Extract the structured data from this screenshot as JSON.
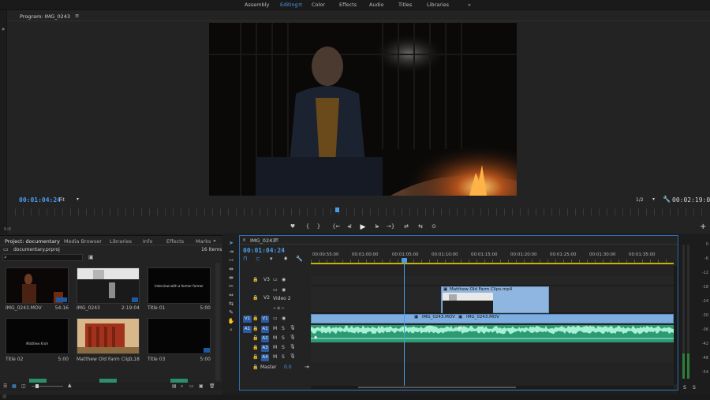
{
  "workspaces": [
    "Assembly",
    "Editing",
    "Color",
    "Effects",
    "Audio",
    "Titles",
    "Libraries"
  ],
  "active_workspace": "Editing",
  "workspace_more": "»",
  "program": {
    "title": "Program: IMG_0243",
    "menu_icon": "≡",
    "timecode": "00:01:04:24",
    "fit": "Fit",
    "resolution": "1/2",
    "duration": "00:02:19:04",
    "controls": [
      "♥",
      "{",
      "}",
      "{←",
      "◂I",
      "▶",
      "I▸",
      "→}",
      "⇄",
      "⇆",
      "⊙"
    ],
    "add": "+",
    "side_arrow": "»",
    "scrub_left": "0:0"
  },
  "project": {
    "tabs": [
      "Project: documentary",
      "Media Browser",
      "Libraries",
      "Info",
      "Effects",
      "Marks"
    ],
    "more": "»",
    "filename": "documentary.prproj",
    "items_count": "16 Items",
    "items": [
      {
        "name": "IMG_0243.MOV",
        "duration": "54:16"
      },
      {
        "name": "IMG_0243",
        "duration": "2:19:04"
      },
      {
        "name": "Title 01",
        "duration": "5:00",
        "thumb_text": "Interview with a former farmer"
      },
      {
        "name": "Title 02",
        "duration": "5:00",
        "thumb_text": "Matthew Kroh"
      },
      {
        "name": "Matthew Old Farm Clip...",
        "duration": "0:18"
      },
      {
        "name": "Title 03",
        "duration": "5:00"
      }
    ]
  },
  "timeline": {
    "title": "IMG_0243",
    "menu_icon": "≡",
    "close": "×",
    "timecode": "00:01:04:24",
    "ruler": [
      "00:00:55:00",
      "00:01:00:00",
      "00:01:05:00",
      "00:01:10:00",
      "00:01:15:00",
      "00:01:20:00",
      "00:01:25:00",
      "00:01:30:00",
      "00:01:35:00"
    ],
    "tracks": {
      "v3": "V3",
      "v2": "V2",
      "v2_name": "Video 2",
      "v1": "V1",
      "v1_src": "V1",
      "a1": "A1",
      "a2": "A2",
      "a3": "A3",
      "a4": "A4",
      "a1_src": "A1",
      "master": "Master",
      "master_val": "0.0"
    },
    "clip_v2": "Matthew Old Farm Clips.mp4",
    "clip_v1a": "IMG_0243.MOV",
    "clip_v1b": "IMG_0243.MOV"
  },
  "meters": {
    "scale": [
      "0",
      "-6",
      "-12",
      "-18",
      "-24",
      "-30",
      "-36",
      "-42",
      "-48",
      "-54"
    ],
    "bottom": [
      "S",
      "S"
    ]
  }
}
